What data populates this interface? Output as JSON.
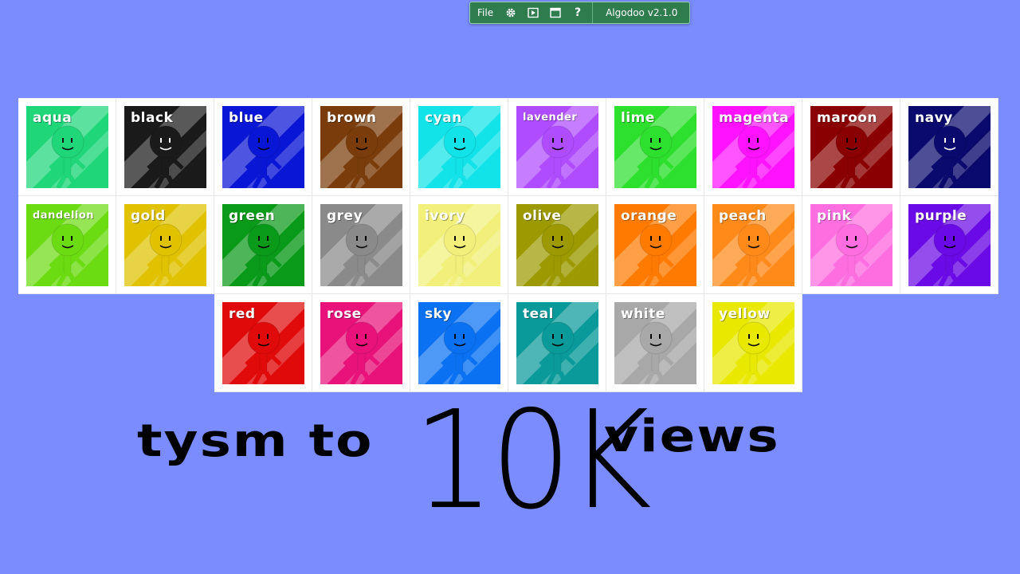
{
  "toolbar": {
    "file_label": "File",
    "icons": [
      "gear-icon",
      "play-icon",
      "window-icon",
      "help-icon"
    ],
    "help_glyph": "?",
    "version": "Algodoo v2.1.0"
  },
  "characters": {
    "row1": [
      {
        "name": "aqua",
        "color": "#1fd679"
      },
      {
        "name": "black",
        "color": "#1a1a1a"
      },
      {
        "name": "blue",
        "color": "#0a16d6"
      },
      {
        "name": "brown",
        "color": "#7a3c0a"
      },
      {
        "name": "cyan",
        "color": "#12e3e8"
      },
      {
        "name": "lavender",
        "color": "#b04cff"
      },
      {
        "name": "lime",
        "color": "#2ee02e"
      },
      {
        "name": "magenta",
        "color": "#ff12ff"
      },
      {
        "name": "maroon",
        "color": "#8a0000"
      },
      {
        "name": "navy",
        "color": "#0a0a6e"
      }
    ],
    "row2": [
      {
        "name": "dandelion",
        "color": "#6cdc12"
      },
      {
        "name": "gold",
        "color": "#e0c200"
      },
      {
        "name": "green",
        "color": "#0a9a1a"
      },
      {
        "name": "grey",
        "color": "#8a8a8a"
      },
      {
        "name": "ivory",
        "color": "#f2f07a"
      },
      {
        "name": "olive",
        "color": "#9c9a00"
      },
      {
        "name": "orange",
        "color": "#ff7a00"
      },
      {
        "name": "peach",
        "color": "#ff8a1a"
      },
      {
        "name": "pink",
        "color": "#ff6ee0"
      },
      {
        "name": "purple",
        "color": "#6a0ae6"
      }
    ],
    "row3": [
      {
        "name": "red",
        "color": "#e00a0a"
      },
      {
        "name": "rose",
        "color": "#e8127a"
      },
      {
        "name": "sky",
        "color": "#0a72f2"
      },
      {
        "name": "teal",
        "color": "#0a9a9a"
      },
      {
        "name": "white",
        "color": "#a8a8a8"
      },
      {
        "name": "yellow",
        "color": "#e8e800"
      }
    ]
  },
  "caption": {
    "left": "tysm to",
    "middle": "10K",
    "right": "views"
  }
}
